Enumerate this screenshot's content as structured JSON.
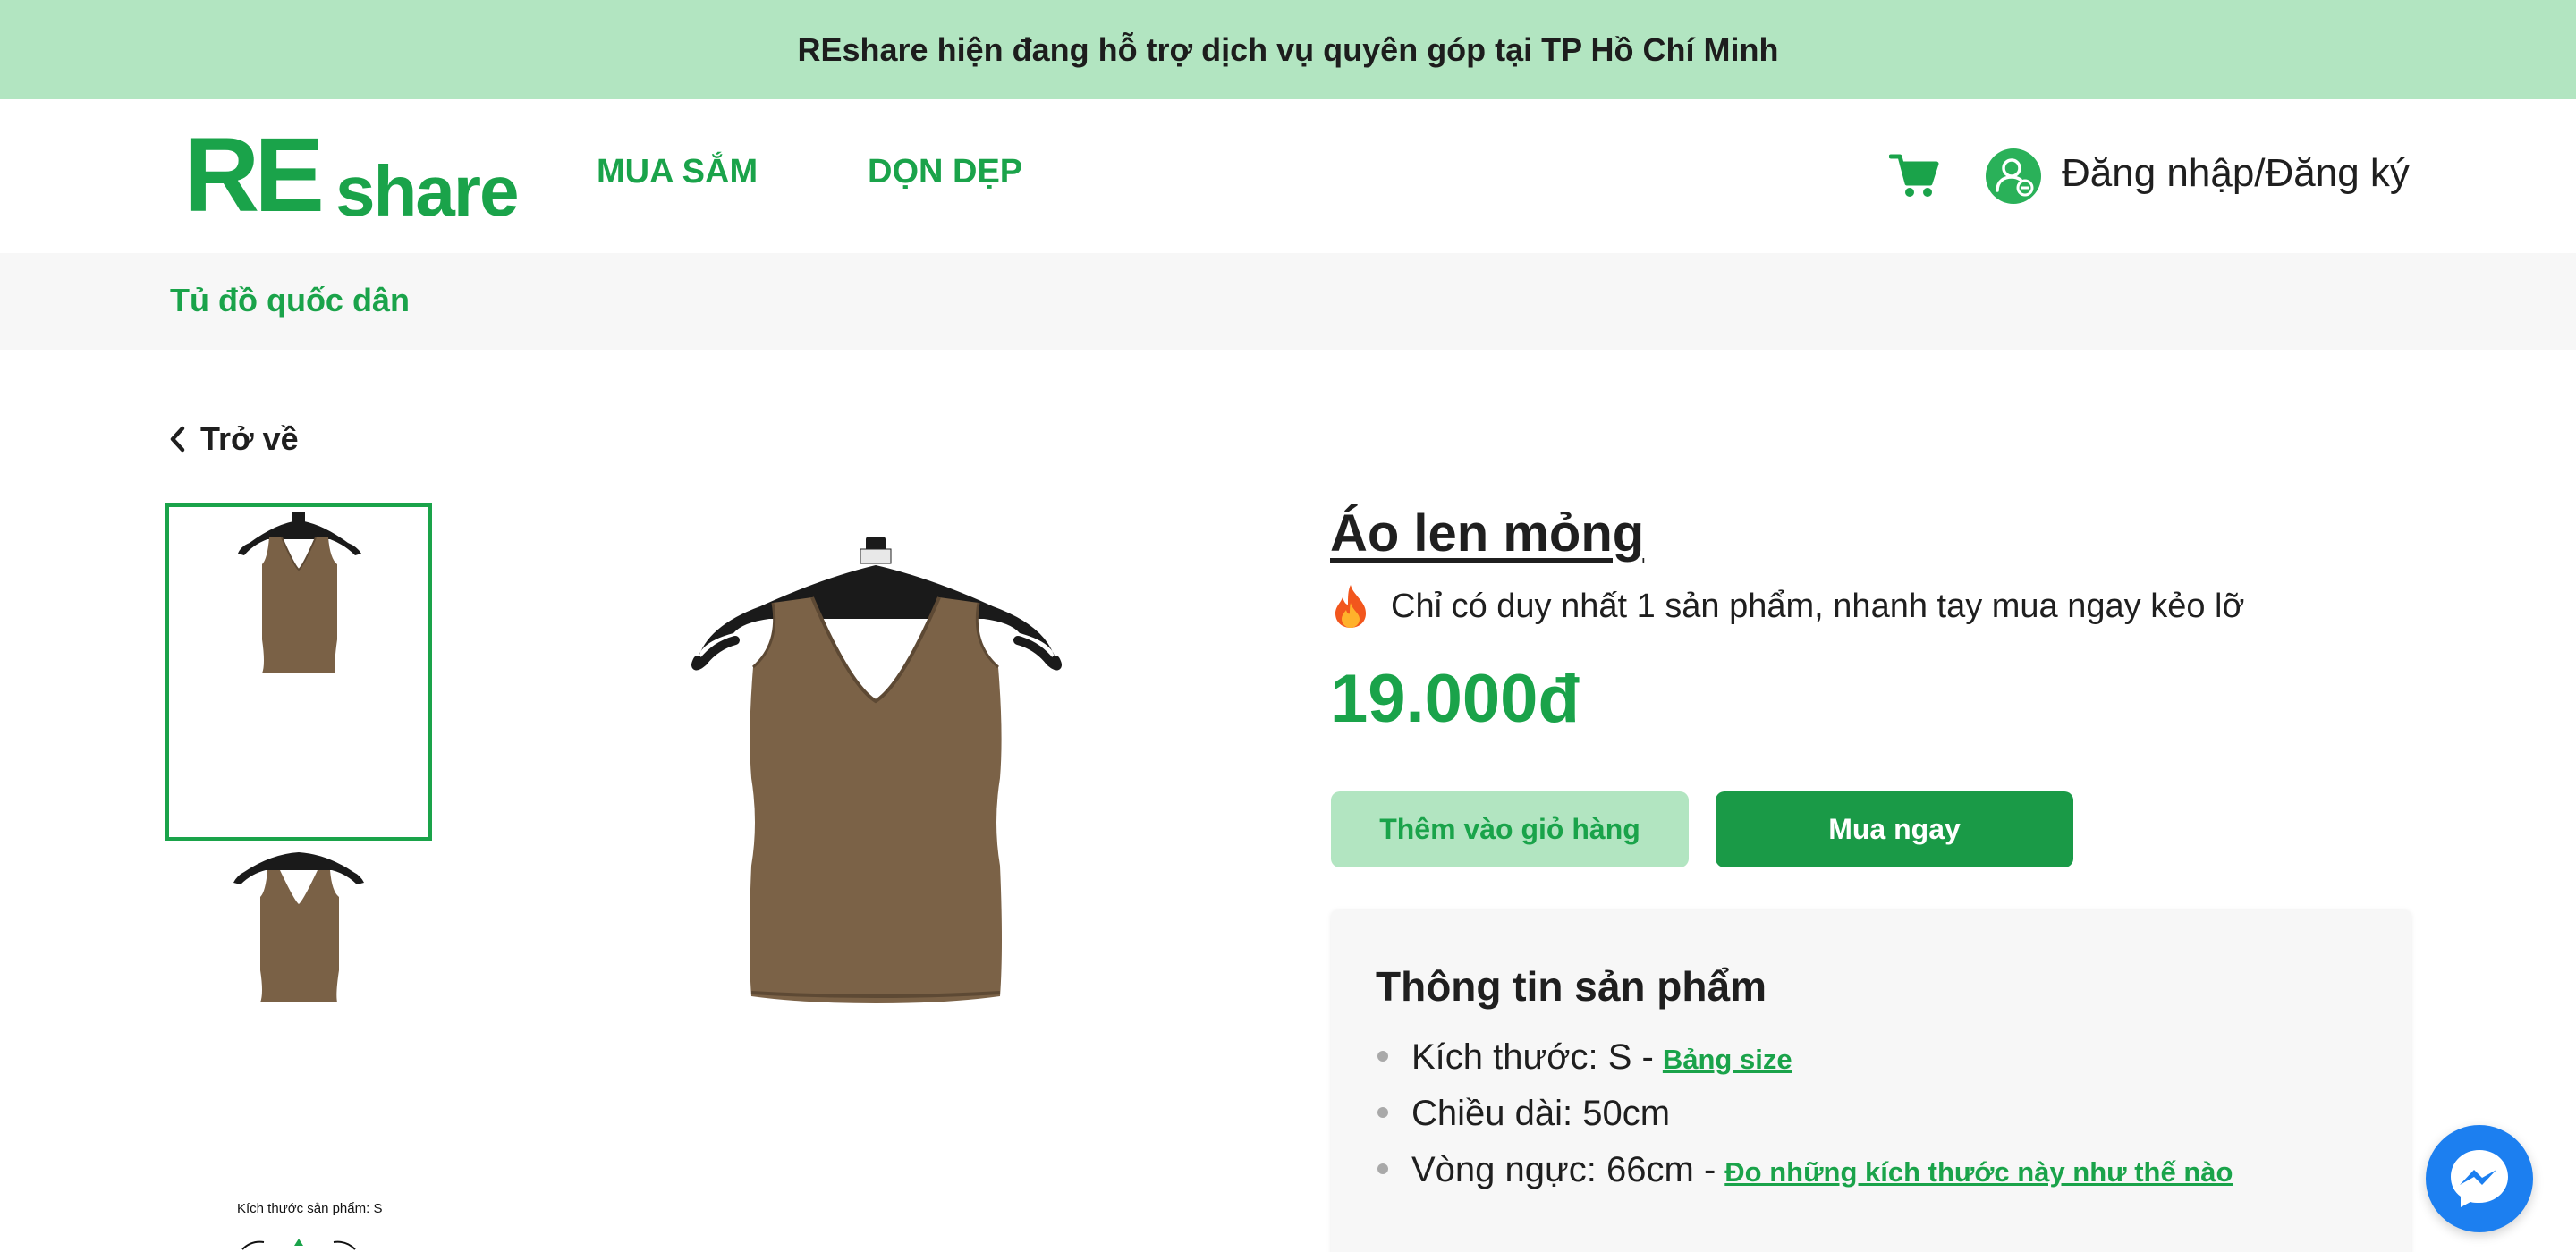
{
  "announcement": "REshare hiện đang hỗ trợ dịch vụ quyên góp tại TP Hồ Chí Minh",
  "header": {
    "logo_re": "RE",
    "logo_share": "share",
    "nav": [
      {
        "label": "MUA SẮM"
      },
      {
        "label": "DỌN DẸP"
      }
    ],
    "cart_icon": "cart-icon",
    "user_icon": "user-icon",
    "login_label": "Đăng nhập/Đăng ký"
  },
  "subbar": {
    "title": "Tủ đồ quốc dân"
  },
  "back_label": "Trở về",
  "gallery": {
    "thumb_caption": "Kích thước sản phẩm: S"
  },
  "product": {
    "title": "Áo len mỏng",
    "stock_note": "Chỉ có duy nhất 1 sản phẩm, nhanh tay mua ngay kẻo lỡ",
    "price": "19.000đ",
    "add_to_cart_label": "Thêm vào giỏ hàng",
    "buy_now_label": "Mua ngay"
  },
  "info": {
    "title": "Thông tin sản phẩm",
    "items": [
      {
        "text": "Kích thước: S -",
        "link": "Bảng size"
      },
      {
        "text": "Chiều dài: 50cm",
        "link": ""
      },
      {
        "text": "Vòng ngực: 66cm -",
        "link": "Đo những kích thước này như thế nào"
      }
    ]
  },
  "colors": {
    "brand_green": "#1aa34a",
    "light_green": "#b2e5c1",
    "messenger_blue": "#1c7ff0"
  }
}
